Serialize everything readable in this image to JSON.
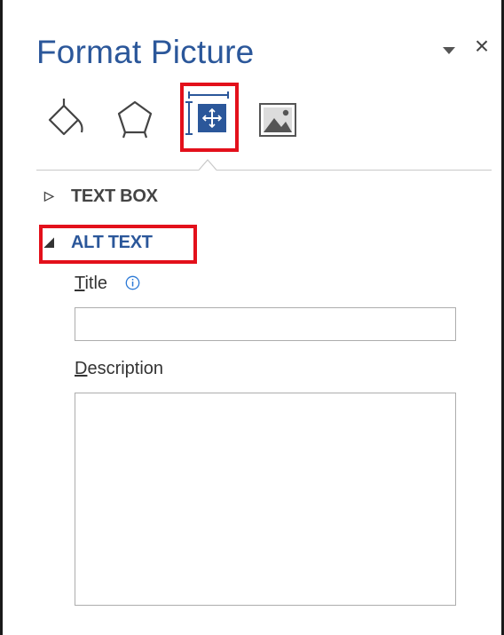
{
  "pane": {
    "title": "Format Picture",
    "options_icon": "dropdown-triangle-icon",
    "close_label": "×"
  },
  "tabs": [
    {
      "name": "Fill & Line",
      "icon": "paint-bucket-icon"
    },
    {
      "name": "Effects",
      "icon": "pentagon-icon"
    },
    {
      "name": "Layout & Properties",
      "icon": "layout-properties-icon",
      "selected": true,
      "highlighted": true
    },
    {
      "name": "Picture",
      "icon": "picture-icon"
    }
  ],
  "sections": {
    "text_box": {
      "label": "TEXT BOX",
      "expanded": false
    },
    "alt_text": {
      "label": "ALT TEXT",
      "expanded": true,
      "highlighted": true
    }
  },
  "fields": {
    "title_label_first": "T",
    "title_label_rest": "itle",
    "title_value": "",
    "description_label_first": "D",
    "description_label_rest": "escription",
    "description_value": ""
  },
  "colors": {
    "accent": "#2b579a",
    "highlight": "#e3101b",
    "text": "#444444"
  }
}
